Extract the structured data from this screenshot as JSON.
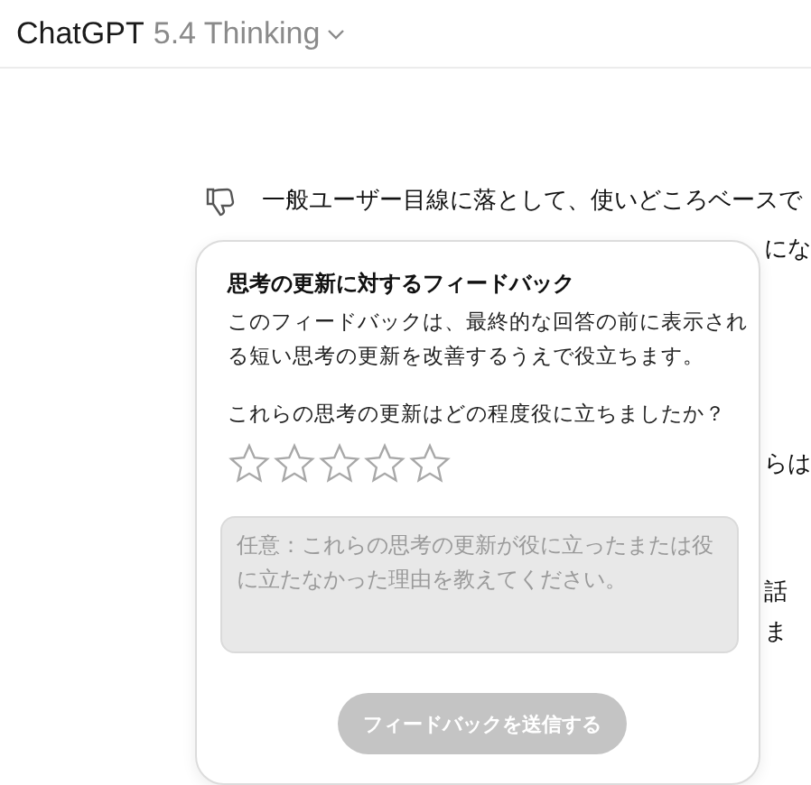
{
  "header": {
    "app_name": "ChatGPT",
    "model": "5.4 Thinking"
  },
  "message": {
    "first_line": "一般ユーザー目線に落として、使いどころベースで",
    "fragments": [
      "にな",
      "らは",
      "話",
      "ま"
    ]
  },
  "feedback": {
    "title": "思考の更新に対するフィードバック",
    "description": "このフィードバックは、最終的な回答の前に表示される短い思考の更新を改善するうえで役立ちます。",
    "question": "これらの思考の更新はどの程度役に立ちましたか？",
    "stars": 0,
    "placeholder": "任意：これらの思考の更新が役に立ったまたは役に立たなかった理由を教えてください。",
    "submit": {
      "label": "フィードバックを送信する",
      "disabled": true
    }
  }
}
